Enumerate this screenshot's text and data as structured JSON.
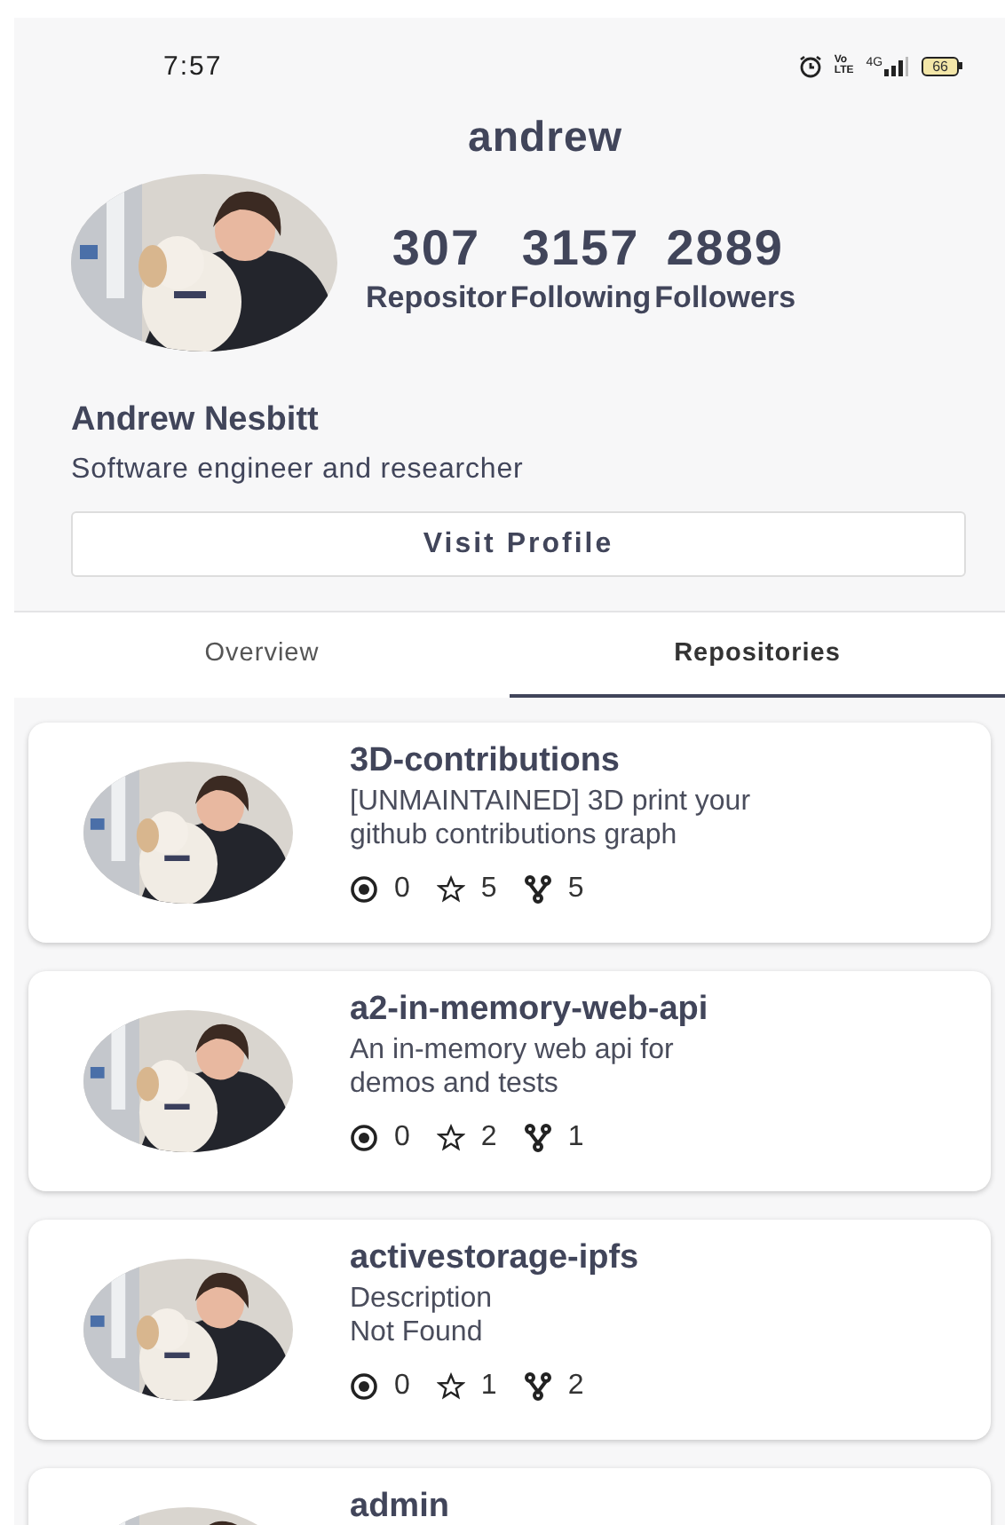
{
  "status_bar": {
    "time": "7:57",
    "volte": [
      "Vo",
      "LTE"
    ],
    "network": "4G",
    "battery": "66"
  },
  "profile": {
    "login": "andrew",
    "stats": [
      {
        "value": "307",
        "label": "Repositor"
      },
      {
        "value": "3157",
        "label": "Following"
      },
      {
        "value": "2889",
        "label": "Followers"
      }
    ],
    "name": "Andrew Nesbitt",
    "bio": "Software engineer and researcher",
    "button": "Visit Profile"
  },
  "tabs": [
    {
      "label": "Overview",
      "selected": false
    },
    {
      "label": "Repositories",
      "selected": true
    }
  ],
  "repositories": [
    {
      "name": "3D-contributions",
      "description": [
        "[UNMAINTAINED] 3D print your",
        "github contributions graph"
      ],
      "watchers": "0",
      "stars": "5",
      "forks": "5"
    },
    {
      "name": "a2-in-memory-web-api",
      "description": [
        "An in-memory web api for",
        "demos and tests"
      ],
      "watchers": "0",
      "stars": "2",
      "forks": "1"
    },
    {
      "name": "activestorage-ipfs",
      "description": [
        "Description",
        "Not Found"
      ],
      "watchers": "0",
      "stars": "1",
      "forks": "2"
    },
    {
      "name": "admin"
    }
  ]
}
